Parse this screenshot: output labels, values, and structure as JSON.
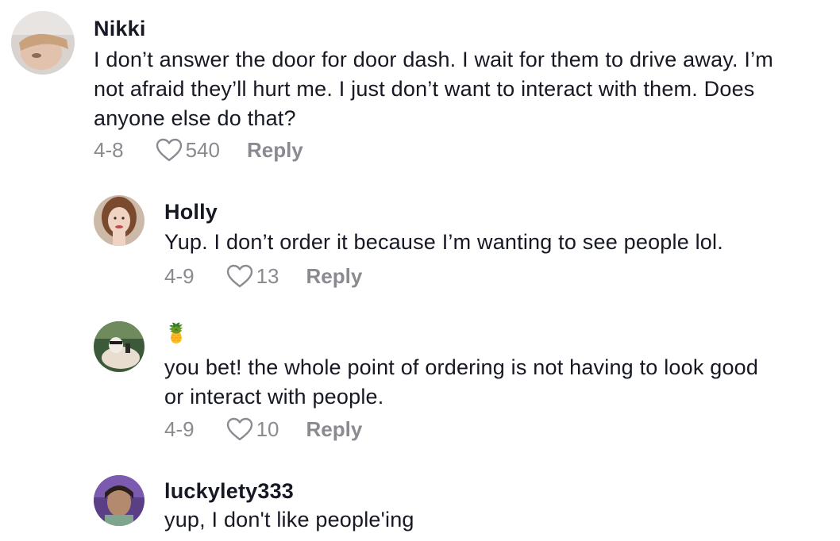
{
  "comments": [
    {
      "username": "Nikki",
      "text_lines": [
        "I don’t answer the door for door dash. I wait for them to drive away. I’m",
        "not afraid they’ll hurt me. I just don’t want to interact with them. Does",
        "anyone else do that?"
      ],
      "date": "4-8",
      "likes": "540",
      "reply_label": "Reply",
      "avatar_icon": "user-avatar-icon"
    }
  ],
  "replies": [
    {
      "username": "Holly",
      "text_lines": [
        "Yup. I don’t order it because I’m wanting to see people lol."
      ],
      "date": "4-9",
      "likes": "13",
      "reply_label": "Reply"
    },
    {
      "username": "🍍",
      "text_lines": [
        "you bet! the whole point of ordering is not having to look good",
        "or interact with people."
      ],
      "date": "4-9",
      "likes": "10",
      "reply_label": "Reply"
    },
    {
      "username": "luckylety333",
      "text_lines": [
        "yup, I don't like people'ing"
      ]
    }
  ],
  "colors": {
    "text": "#161823",
    "meta": "#8a8b91",
    "background": "#ffffff"
  },
  "icons": {
    "like": "heart-outline-icon"
  }
}
